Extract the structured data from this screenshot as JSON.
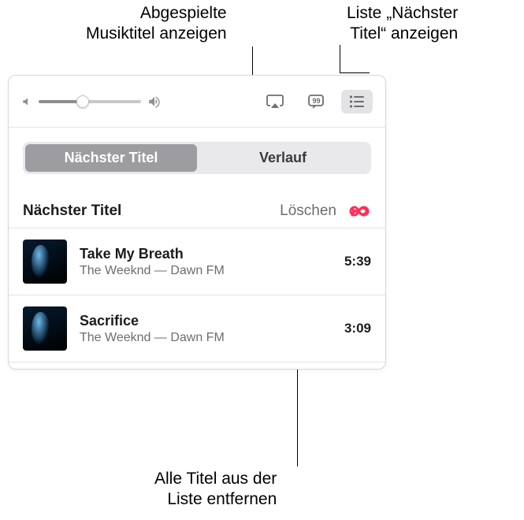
{
  "callouts": {
    "top_left": "Abgespielte\nMusiktitel anzeigen",
    "top_right": "Liste „Nächster\nTitel“ anzeigen",
    "bottom": "Alle Titel aus der\nListe entfernen"
  },
  "segmented": {
    "upnext": "Nächster Titel",
    "history": "Verlauf"
  },
  "section": {
    "title": "Nächster Titel",
    "clear": "Löschen"
  },
  "tracks": [
    {
      "title": "Take My Breath",
      "sub": "The Weeknd — Dawn FM",
      "time": "5:39"
    },
    {
      "title": "Sacrifice",
      "sub": "The Weeknd — Dawn FM",
      "time": "3:09"
    }
  ]
}
